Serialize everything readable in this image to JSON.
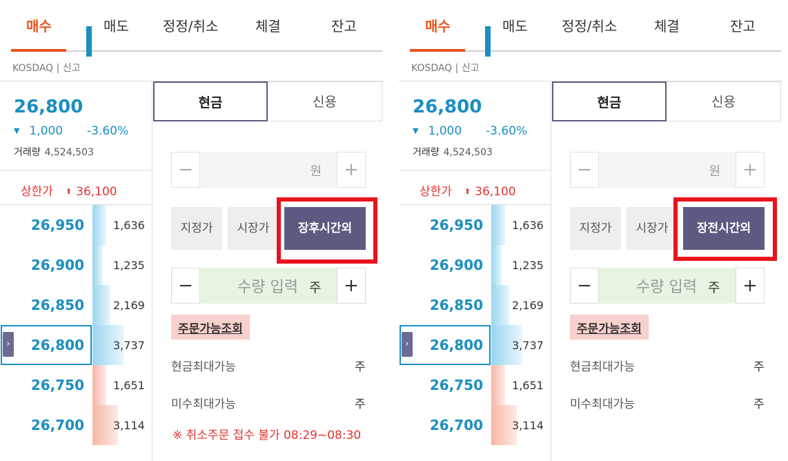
{
  "accent_color": "#e8531a",
  "ask_color": "#1a8ec1",
  "bid_color": "#e1352f",
  "highlight_color": "#e8131d",
  "panels": [
    {
      "tabs": [
        "매수",
        "매도",
        "정정/취소",
        "체결",
        "잔고"
      ],
      "active_tab": "매수",
      "market_label": "KOSDAQ | 신고",
      "current_price": "26,800",
      "change_value": "1,000",
      "change_rate": "-3.60%",
      "volume_label": "거래량",
      "volume_value": "4,524,503",
      "upper_limit_label": "상한가",
      "upper_limit_value": "36,100",
      "orderbook": [
        {
          "price": "26,950",
          "qty": "1,636",
          "side": "ask"
        },
        {
          "price": "26,900",
          "qty": "1,235",
          "side": "ask"
        },
        {
          "price": "26,850",
          "qty": "2,169",
          "side": "ask"
        },
        {
          "price": "26,800",
          "qty": "3,737",
          "side": "ask",
          "current": true
        },
        {
          "price": "26,750",
          "qty": "1,651",
          "side": "bid"
        },
        {
          "price": "26,700",
          "qty": "3,114",
          "side": "bid"
        }
      ],
      "credit_tabs": {
        "cash": "현금",
        "credit": "신용"
      },
      "price_unit": "원",
      "order_types": [
        "지정가",
        "시장가",
        "장후시간외"
      ],
      "selected_order_type": "장후시간외",
      "quantity_placeholder": "수량 입력",
      "quantity_unit": "주",
      "available_link": "주문가능조회",
      "cash_max_label": "현금최대가능",
      "cash_max_unit": "주",
      "credit_max_label": "미수최대가능",
      "credit_max_unit": "주",
      "notice": "※ 취소주문 접수 불가 08:29~08:30"
    },
    {
      "tabs": [
        "매수",
        "매도",
        "정정/취소",
        "체결",
        "잔고"
      ],
      "active_tab": "매수",
      "market_label": "KOSDAQ | 신고",
      "current_price": "26,800",
      "change_value": "1,000",
      "change_rate": "-3.60%",
      "volume_label": "거래량",
      "volume_value": "4,524,503",
      "upper_limit_label": "상한가",
      "upper_limit_value": "36,100",
      "orderbook": [
        {
          "price": "26,950",
          "qty": "1,636",
          "side": "ask"
        },
        {
          "price": "26,900",
          "qty": "1,235",
          "side": "ask"
        },
        {
          "price": "26,850",
          "qty": "2,169",
          "side": "ask"
        },
        {
          "price": "26,800",
          "qty": "3,737",
          "side": "ask",
          "current": true
        },
        {
          "price": "26,750",
          "qty": "1,651",
          "side": "bid"
        },
        {
          "price": "26,700",
          "qty": "3,114",
          "side": "bid"
        }
      ],
      "credit_tabs": {
        "cash": "현금",
        "credit": "신용"
      },
      "price_unit": "원",
      "order_types": [
        "지정가",
        "시장가",
        "장전시간외"
      ],
      "selected_order_type": "장전시간외",
      "quantity_placeholder": "수량 입력",
      "quantity_unit": "주",
      "available_link": "주문가능조회",
      "cash_max_label": "현금최대가능",
      "cash_max_unit": "주",
      "credit_max_label": "미수최대가능",
      "credit_max_unit": "주"
    }
  ]
}
